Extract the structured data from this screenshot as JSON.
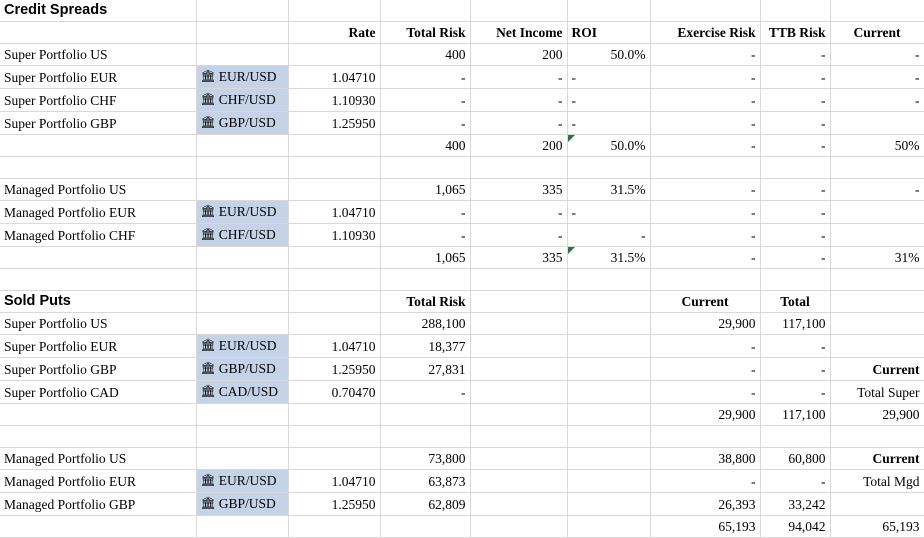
{
  "columns": {
    "rate": "Rate",
    "total_risk": "Total Risk",
    "net_income": "Net Income",
    "roi": "ROI",
    "exercise_risk": "Exercise Risk",
    "ttb_risk": "TTB Risk",
    "current": "Current",
    "total": "Total"
  },
  "icons": {
    "bank": "🏛"
  },
  "colors": {
    "fx_highlight": "#c5d3e8",
    "error_flag": "#1f7a33",
    "gridline": "#d9d9d9"
  },
  "sections": {
    "credit_spreads": {
      "title": "Credit Spreads",
      "super": {
        "rows": [
          {
            "name": "Super Portfolio US",
            "pair": "",
            "rate": "",
            "total_risk": "400",
            "net_income": "200",
            "roi": "50.0%",
            "exercise_risk": "-",
            "ttb_risk": "-",
            "current": "-"
          },
          {
            "name": "Super Portfolio EUR",
            "pair": "EUR/USD",
            "rate": "1.04710",
            "total_risk": "-",
            "net_income": "-",
            "roi": "-",
            "exercise_risk": "-",
            "ttb_risk": "-",
            "current": "-"
          },
          {
            "name": "Super Portfolio CHF",
            "pair": "CHF/USD",
            "rate": "1.10930",
            "total_risk": "-",
            "net_income": "-",
            "roi": "-",
            "exercise_risk": "-",
            "ttb_risk": "-",
            "current": "-"
          },
          {
            "name": "Super Portfolio GBP",
            "pair": "GBP/USD",
            "rate": "1.25950",
            "total_risk": "-",
            "net_income": "-",
            "roi": "-",
            "exercise_risk": "-",
            "ttb_risk": "-",
            "current": ""
          }
        ],
        "total": {
          "total_risk": "400",
          "net_income": "200",
          "roi": "50.0%",
          "exercise_risk": "-",
          "ttb_risk": "-",
          "current": "50%"
        }
      },
      "managed": {
        "rows": [
          {
            "name": "Managed Portfolio US",
            "pair": "",
            "rate": "",
            "total_risk": "1,065",
            "net_income": "335",
            "roi": "31.5%",
            "exercise_risk": "-",
            "ttb_risk": "-",
            "current": "-"
          },
          {
            "name": "Managed Portfolio EUR",
            "pair": "EUR/USD",
            "rate": "1.04710",
            "total_risk": "-",
            "net_income": "-",
            "roi": "-",
            "exercise_risk": "-",
            "ttb_risk": "-",
            "current": ""
          },
          {
            "name": "Managed Portfolio CHF",
            "pair": "CHF/USD",
            "rate": "1.10930",
            "total_risk": "-",
            "net_income": "-",
            "roi": "-",
            "exercise_risk": "-",
            "ttb_risk": "-",
            "current": ""
          }
        ],
        "total": {
          "total_risk": "1,065",
          "net_income": "335",
          "roi": "31.5%",
          "exercise_risk": "-",
          "ttb_risk": "-",
          "current": "31%"
        }
      }
    },
    "sold_puts": {
      "title": "Sold Puts",
      "super": {
        "rows": [
          {
            "name": "Super Portfolio US",
            "pair": "",
            "rate": "",
            "total_risk": "288,100",
            "current": "29,900",
            "total": "117,100",
            "note": ""
          },
          {
            "name": "Super Portfolio EUR",
            "pair": "EUR/USD",
            "rate": "1.04710",
            "total_risk": "18,377",
            "current": "-",
            "total": "-",
            "note": ""
          },
          {
            "name": "Super Portfolio GBP",
            "pair": "GBP/USD",
            "rate": "1.25950",
            "total_risk": "27,831",
            "current": "-",
            "total": "-",
            "note": "Current"
          },
          {
            "name": "Super Portfolio CAD",
            "pair": "CAD/USD",
            "rate": "0.70470",
            "total_risk": "-",
            "current": "-",
            "total": "-",
            "note": "Total Super"
          }
        ],
        "total": {
          "current": "29,900",
          "total": "117,100",
          "note": "29,900"
        }
      },
      "managed": {
        "rows": [
          {
            "name": "Managed Portfolio US",
            "pair": "",
            "rate": "",
            "total_risk": "73,800",
            "current": "38,800",
            "total": "60,800",
            "note": "Current"
          },
          {
            "name": "Managed Portfolio EUR",
            "pair": "EUR/USD",
            "rate": "1.04710",
            "total_risk": "63,873",
            "current": "-",
            "total": "-",
            "note": "Total Mgd"
          },
          {
            "name": "Managed Portfolio GBP",
            "pair": "GBP/USD",
            "rate": "1.25950",
            "total_risk": "62,809",
            "current": "26,393",
            "total": "33,242",
            "note": ""
          }
        ],
        "total": {
          "current": "65,193",
          "total": "94,042",
          "note": "65,193"
        }
      }
    }
  }
}
